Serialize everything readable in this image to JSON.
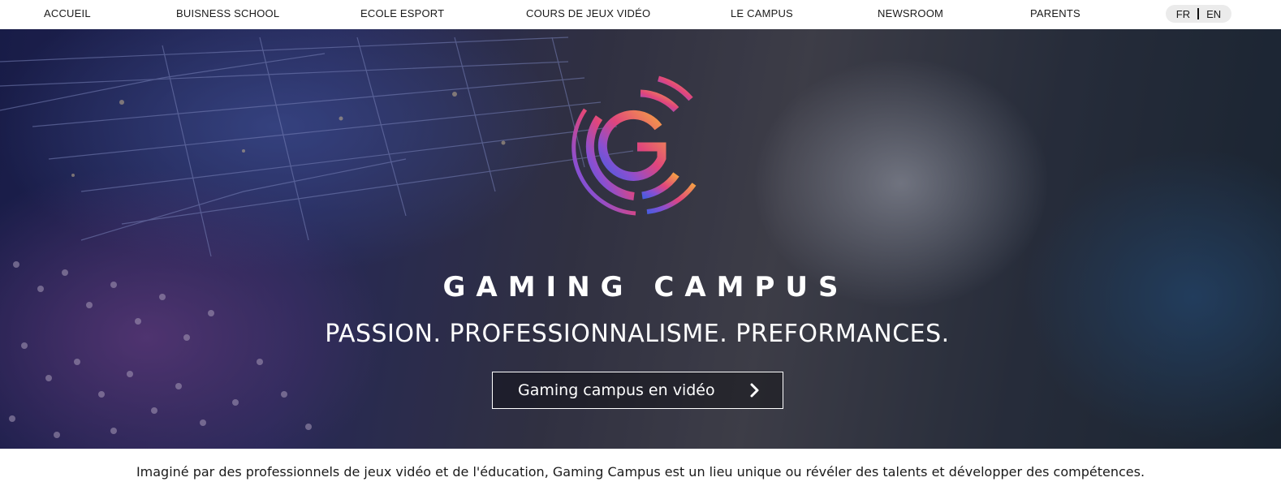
{
  "nav": {
    "items": [
      {
        "label": "ACCUEIL"
      },
      {
        "label": "BUISNESS SCHOOL"
      },
      {
        "label": "ECOLE ESPORT"
      },
      {
        "label": "COURS DE JEUX VIDÉO"
      },
      {
        "label": "LE CAMPUS"
      },
      {
        "label": "NEWSROOM"
      },
      {
        "label": "PARENTS"
      }
    ],
    "languages": {
      "fr": "FR",
      "en": "EN"
    }
  },
  "hero": {
    "brand": "GAMING CAMPUS",
    "tagline": "PASSION. PROFESSIONNALISME. PREFORMANCES.",
    "video_button": "Gaming campus en vidéo",
    "logo_icon": "gaming-campus-g-logo",
    "colors": {
      "logo_orange": "#f5a044",
      "logo_pink": "#e0457d",
      "logo_purple": "#7a4fd6",
      "logo_blue": "#4a5ce0"
    }
  },
  "intro": {
    "text": "Imaginé par des professionnels de jeux vidéo et de l'éducation, Gaming Campus est un lieu unique ou révéler des talents et développer des compétences."
  }
}
